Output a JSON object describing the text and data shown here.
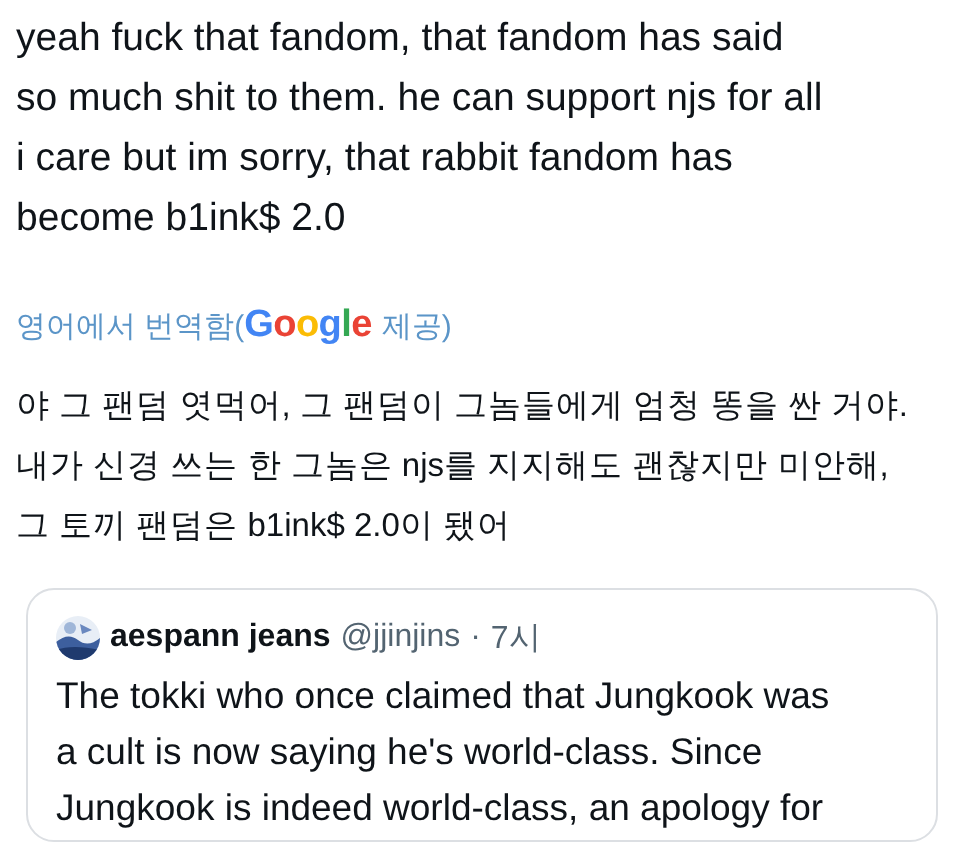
{
  "post": {
    "text": "yeah fuck that fandom, that fandom has said\nso much shit to them. he can support njs for all\ni care but im sorry, that rabbit fandom has\nbecome b1ink$ 2.0"
  },
  "translation": {
    "label_before": "영어에서 번역함(",
    "logo": "Google",
    "label_after": "제공)",
    "text": "야 그 팬덤 엿먹어, 그 팬덤이 그놈들에게 엄청 똥을 싼 거야.\n내가 신경 쓰는 한 그놈은 njs를 지지해도 괜찮지만 미안해,\n그 토끼 팬덤은 b1ink$ 2.0이 됐어"
  },
  "quote": {
    "name": "aespann jeans",
    "handle": "@jjinjins",
    "separator": "·",
    "time": "7시",
    "text": "The tokki who once claimed that Jungkook was\na cult is now saying he's world-class. Since\nJungkook is indeed world-class, an apology for"
  }
}
